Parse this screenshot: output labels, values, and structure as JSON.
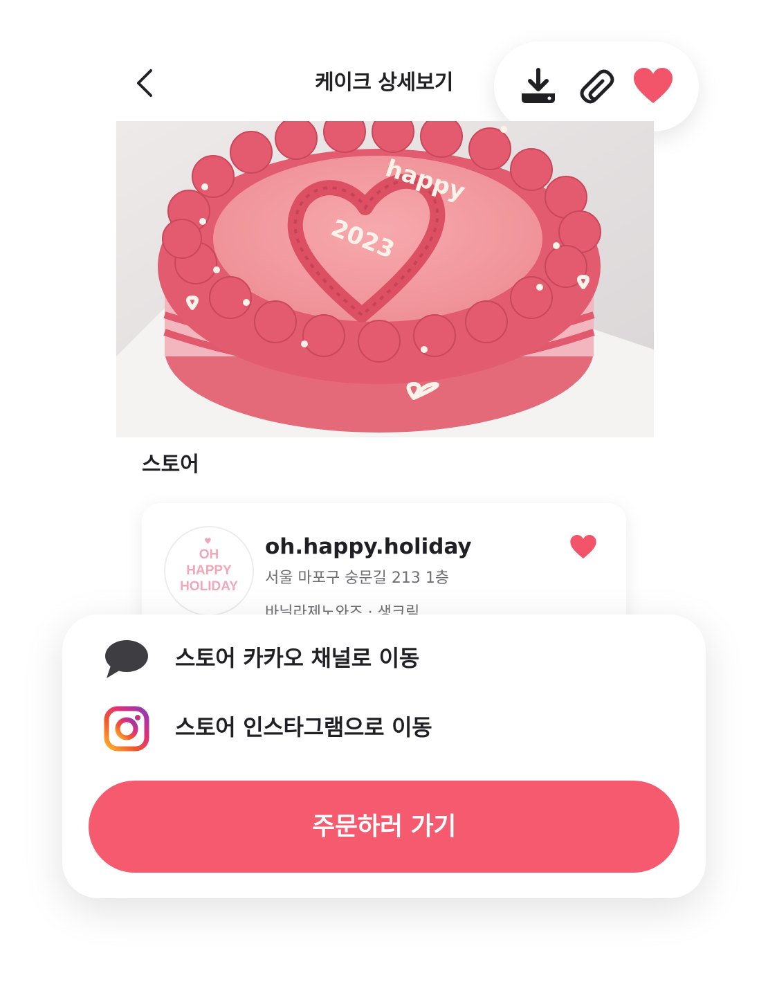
{
  "header": {
    "title": "케이크 상세보기",
    "back_icon": "chevron-left-icon",
    "actions": [
      "download-icon",
      "paperclip-icon",
      "heart-icon"
    ]
  },
  "cake": {
    "image_icon": "cake-photo",
    "topper_line1": "happy",
    "topper_line2": "2023"
  },
  "store_section": {
    "title": "스토어",
    "store": {
      "avatar_text": "OH\nHAPPY\nHOLIDAY",
      "name": "oh.happy.holiday",
      "address": "서울 마포구 숭문길 213 1층",
      "tags": "바닐라제노와즈 · 생크림"
    }
  },
  "sheet": {
    "kakao_label": "스토어 카카오 채널로 이동",
    "instagram_label": "스토어 인스타그램으로 이동",
    "order_button": "주문하러 가기"
  },
  "colors": {
    "accent": "#f55a6e",
    "heart": "#f25569",
    "chat_icon": "#3d3d42"
  }
}
